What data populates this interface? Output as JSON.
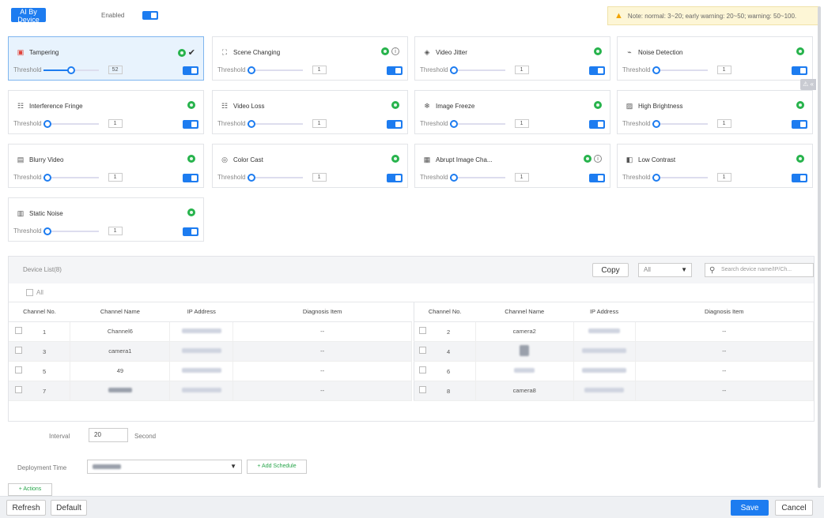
{
  "topbar": {
    "ai_button": "AI By Device",
    "enabled_label": "Enabled",
    "note": "Note: normal: 3~20; early warning: 20~50; warning: 50~100."
  },
  "cards": [
    {
      "title": "Tampering",
      "threshold_label": "Threshold",
      "value": "52",
      "info": false,
      "check": true
    },
    {
      "title": "Scene Changing",
      "threshold_label": "Threshold",
      "value": "1",
      "info": true,
      "check": false
    },
    {
      "title": "Video Jitter",
      "threshold_label": "Threshold",
      "value": "1",
      "info": false,
      "check": false
    },
    {
      "title": "Noise Detection",
      "threshold_label": "Threshold",
      "value": "1",
      "info": false,
      "check": false
    },
    {
      "title": "Interference Fringe",
      "threshold_label": "Threshold",
      "value": "1",
      "info": false,
      "check": false
    },
    {
      "title": "Video Loss",
      "threshold_label": "Threshold",
      "value": "1",
      "info": false,
      "check": false
    },
    {
      "title": "Image Freeze",
      "threshold_label": "Threshold",
      "value": "1",
      "info": false,
      "check": false
    },
    {
      "title": "High Brightness",
      "threshold_label": "Threshold",
      "value": "1",
      "info": false,
      "check": false
    },
    {
      "title": "Blurry Video",
      "threshold_label": "Threshold",
      "value": "1",
      "info": false,
      "check": false
    },
    {
      "title": "Color Cast",
      "threshold_label": "Threshold",
      "value": "1",
      "info": false,
      "check": false
    },
    {
      "title": "Abrupt Image Cha...",
      "threshold_label": "Threshold",
      "value": "1",
      "info": true,
      "check": false
    },
    {
      "title": "Low Contrast",
      "threshold_label": "Threshold",
      "value": "1",
      "info": false,
      "check": false
    },
    {
      "title": "Static Noise",
      "threshold_label": "Threshold",
      "value": "1",
      "info": false,
      "check": false
    }
  ],
  "device_list": {
    "label": "Device List(8)",
    "copy_label": "Copy",
    "filter_value": "All",
    "search_placeholder": "Search device name/IP/Ch...",
    "all_label": "All",
    "columns": [
      "Channel No.",
      "Channel Name",
      "IP Address",
      "Diagnosis Item"
    ],
    "left_rows": [
      {
        "no": "1",
        "name": "Channel6",
        "diag": "--"
      },
      {
        "no": "3",
        "name": "camera1",
        "diag": "--"
      },
      {
        "no": "5",
        "name": "49",
        "diag": "--"
      },
      {
        "no": "7",
        "name": "",
        "diag": "--"
      }
    ],
    "right_rows": [
      {
        "no": "2",
        "name": "camera2",
        "diag": "--"
      },
      {
        "no": "4",
        "name": "",
        "diag": "--"
      },
      {
        "no": "6",
        "name": "",
        "diag": "--"
      },
      {
        "no": "8",
        "name": "camera8",
        "diag": "--"
      }
    ]
  },
  "form": {
    "interval_label": "Interval",
    "interval_value": "20",
    "second_label": "Second",
    "deployment_label": "Deployment Time",
    "add_schedule": "+ Add Schedule",
    "actions": "+ Actions"
  },
  "footer": {
    "refresh": "Refresh",
    "default": "Default",
    "save": "Save",
    "cancel": "Cancel"
  },
  "colors": {
    "accent": "#1d7cf0",
    "ok": "#27b34c",
    "add_green": "#27a54a"
  }
}
